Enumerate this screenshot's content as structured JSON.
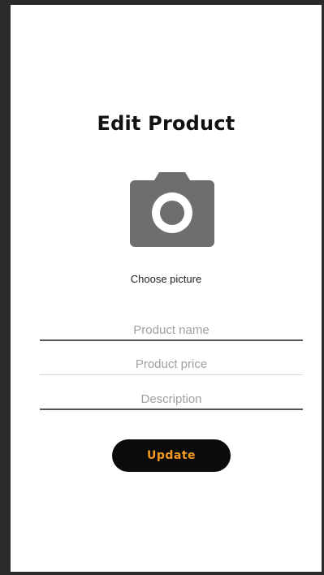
{
  "page": {
    "title": "Edit Product"
  },
  "picture": {
    "icon": "camera-icon",
    "label": "Choose picture"
  },
  "form": {
    "name": {
      "value": "",
      "placeholder": "Product name"
    },
    "price": {
      "value": "",
      "placeholder": "Product price"
    },
    "description": {
      "value": "",
      "placeholder": "Description"
    }
  },
  "actions": {
    "update_label": "Update"
  },
  "colors": {
    "accent": "#f59a1e",
    "button_bg": "#0b0b0b",
    "icon": "#6e6e6e"
  }
}
